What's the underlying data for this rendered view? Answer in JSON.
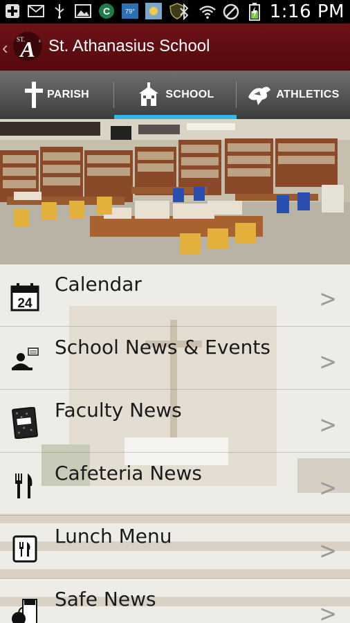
{
  "status_bar": {
    "time": "1:16 PM",
    "weather_temp": "79°",
    "icons": [
      "add-icon",
      "mail-icon",
      "usb-icon",
      "image-icon",
      "app-c-icon",
      "weather-icon",
      "sunny-icon",
      "shield-icon",
      "bluetooth-icon",
      "wifi-icon",
      "blocked-icon",
      "battery-charging-icon"
    ]
  },
  "action_bar": {
    "title": "St. Athanasius School",
    "logo_text": "ST.A"
  },
  "tabs": [
    {
      "label": "PARISH",
      "icon": "cross-icon",
      "active": false
    },
    {
      "label": "SCHOOL",
      "icon": "schoolhouse-icon",
      "active": true
    },
    {
      "label": "ATHLETICS",
      "icon": "mascot-icon",
      "active": false
    }
  ],
  "banner": {
    "description_icon": "library-photo"
  },
  "menu": {
    "arrow": ">",
    "calendar_day": "24",
    "items": [
      {
        "label": "Calendar",
        "icon": "calendar-icon"
      },
      {
        "label": "School News & Events",
        "icon": "news-presenter-icon"
      },
      {
        "label": "Faculty News",
        "icon": "notebook-icon"
      },
      {
        "label": "Cafeteria News",
        "icon": "fork-knife-icon"
      },
      {
        "label": "Lunch Menu",
        "icon": "menu-card-icon"
      },
      {
        "label": "Safe News",
        "icon": "apple-bag-icon"
      }
    ]
  },
  "colors": {
    "action_bar": "#5e0c12",
    "tab_indicator": "#33b5e5",
    "tab_bar": "#505050"
  }
}
